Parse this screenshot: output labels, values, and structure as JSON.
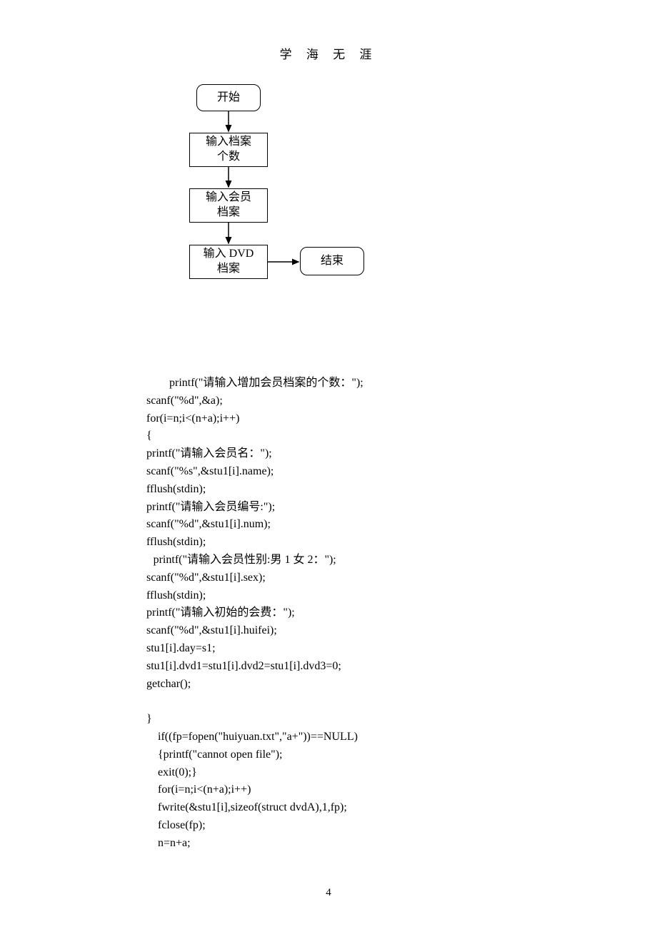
{
  "header": "学 海 无  涯",
  "flow": {
    "start": "开始",
    "step1_l1": "输入档案",
    "step1_l2": "个数",
    "step2_l1": "输入会员",
    "step2_l2": "档案",
    "step3_l1": "输入 DVD",
    "step3_l2": "档案",
    "end": "结束"
  },
  "code": {
    "l1": "printf(\"请输入增加会员档案的个数：\");",
    "l2": "scanf(\"%d\",&a);",
    "l3": "for(i=n;i<(n+a);i++)",
    "l4": "{",
    "l5": "printf(\"请输入会员名：\");",
    "l6": "scanf(\"%s\",&stu1[i].name);",
    "l7": "fflush(stdin);",
    "l8": "printf(\"请输入会员编号:\");",
    "l9": "scanf(\"%d\",&stu1[i].num);",
    "l10": "fflush(stdin);",
    "l11": "printf(\"请输入会员性别:男 1 女 2：\");",
    "l12": "scanf(\"%d\",&stu1[i].sex);",
    "l13": "fflush(stdin);",
    "l14": "printf(\"请输入初始的会费：\");",
    "l15": "scanf(\"%d\",&stu1[i].huifei);",
    "l16": "stu1[i].day=s1;",
    "l17": "stu1[i].dvd1=stu1[i].dvd2=stu1[i].dvd3=0;",
    "l18": "getchar();",
    "l19": "}",
    "l20": "if((fp=fopen(\"huiyuan.txt\",\"a+\"))==NULL)",
    "l21": "{printf(\"cannot open file\");",
    "l22": "exit(0);}",
    "l23": "for(i=n;i<(n+a);i++)",
    "l24": "fwrite(&stu1[i],sizeof(struct dvdA),1,fp);",
    "l25": "fclose(fp);",
    "l26": "n=n+a;"
  },
  "page_number": "4"
}
